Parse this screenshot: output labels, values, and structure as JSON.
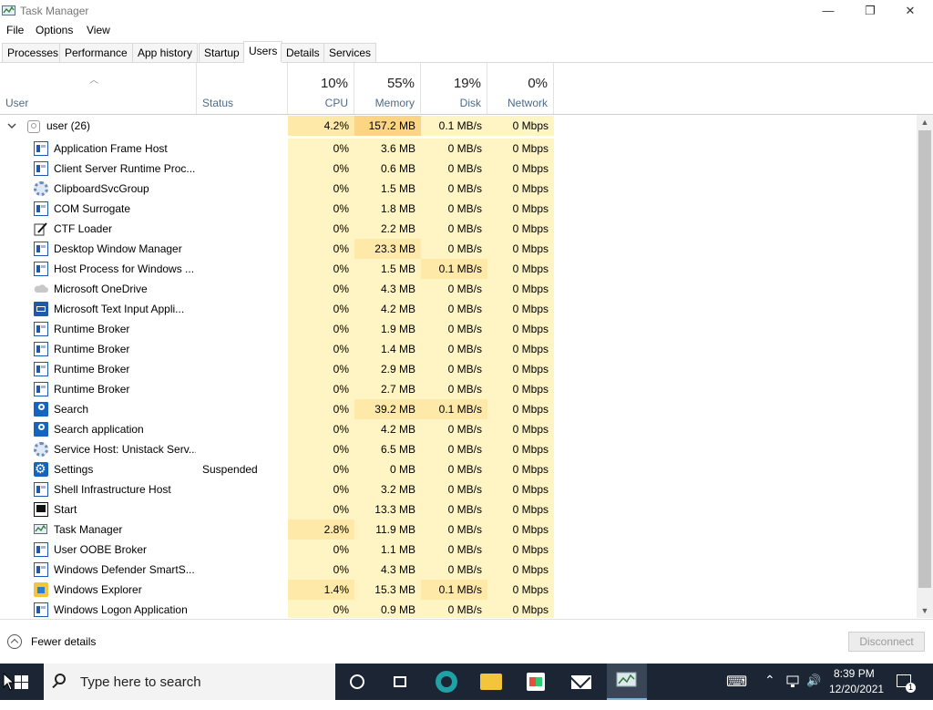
{
  "window": {
    "title": "Task Manager",
    "min_glyph": "—",
    "max_glyph": "❐",
    "close_glyph": "✕"
  },
  "menu": [
    "File",
    "Options",
    "View"
  ],
  "tabs": [
    {
      "label": "Processes",
      "active": false
    },
    {
      "label": "Performance",
      "active": false
    },
    {
      "label": "App history",
      "active": false
    },
    {
      "label": "Startup",
      "active": false
    },
    {
      "label": "Users",
      "active": true
    },
    {
      "label": "Details",
      "active": false
    },
    {
      "label": "Services",
      "active": false
    }
  ],
  "columns": {
    "user": "User",
    "status": "Status",
    "cpu": {
      "pct": "10%",
      "label": "CPU"
    },
    "memory": {
      "pct": "55%",
      "label": "Memory"
    },
    "disk": {
      "pct": "19%",
      "label": "Disk"
    },
    "network": {
      "pct": "0%",
      "label": "Network"
    }
  },
  "user_row": {
    "name": "user (26)",
    "cpu": "4.2%",
    "memory": "157.2 MB",
    "disk": "0.1 MB/s",
    "network": "0 Mbps"
  },
  "processes": [
    {
      "icon": "window-icon",
      "name": "Application Frame Host",
      "status": "",
      "cpu": "0%",
      "memory": "3.6 MB",
      "disk": "0 MB/s",
      "network": "0 Mbps"
    },
    {
      "icon": "window-icon",
      "name": "Client Server Runtime Proc...",
      "status": "",
      "cpu": "0%",
      "memory": "0.6 MB",
      "disk": "0 MB/s",
      "network": "0 Mbps"
    },
    {
      "icon": "gear-icon",
      "name": "ClipboardSvcGroup",
      "status": "",
      "cpu": "0%",
      "memory": "1.5 MB",
      "disk": "0 MB/s",
      "network": "0 Mbps"
    },
    {
      "icon": "window-icon",
      "name": "COM Surrogate",
      "status": "",
      "cpu": "0%",
      "memory": "1.8 MB",
      "disk": "0 MB/s",
      "network": "0 Mbps"
    },
    {
      "icon": "pen-icon",
      "name": "CTF Loader",
      "status": "",
      "cpu": "0%",
      "memory": "2.2 MB",
      "disk": "0 MB/s",
      "network": "0 Mbps"
    },
    {
      "icon": "window-icon",
      "name": "Desktop Window Manager",
      "status": "",
      "cpu": "0%",
      "memory": "23.3 MB",
      "disk": "0 MB/s",
      "network": "0 Mbps"
    },
    {
      "icon": "window-icon",
      "name": "Host Process for Windows ...",
      "status": "",
      "cpu": "0%",
      "memory": "1.5 MB",
      "disk": "0.1 MB/s",
      "network": "0 Mbps"
    },
    {
      "icon": "cloud-icon",
      "name": "Microsoft OneDrive",
      "status": "",
      "cpu": "0%",
      "memory": "4.3 MB",
      "disk": "0 MB/s",
      "network": "0 Mbps"
    },
    {
      "icon": "keyboard-icon",
      "name": "Microsoft Text Input Appli...",
      "status": "",
      "cpu": "0%",
      "memory": "4.2 MB",
      "disk": "0 MB/s",
      "network": "0 Mbps"
    },
    {
      "icon": "window-icon",
      "name": "Runtime Broker",
      "status": "",
      "cpu": "0%",
      "memory": "1.9 MB",
      "disk": "0 MB/s",
      "network": "0 Mbps"
    },
    {
      "icon": "window-icon",
      "name": "Runtime Broker",
      "status": "",
      "cpu": "0%",
      "memory": "1.4 MB",
      "disk": "0 MB/s",
      "network": "0 Mbps"
    },
    {
      "icon": "window-icon",
      "name": "Runtime Broker",
      "status": "",
      "cpu": "0%",
      "memory": "2.9 MB",
      "disk": "0 MB/s",
      "network": "0 Mbps"
    },
    {
      "icon": "window-icon",
      "name": "Runtime Broker",
      "status": "",
      "cpu": "0%",
      "memory": "2.7 MB",
      "disk": "0 MB/s",
      "network": "0 Mbps"
    },
    {
      "icon": "search-icon",
      "name": "Search",
      "status": "",
      "cpu": "0%",
      "memory": "39.2 MB",
      "disk": "0.1 MB/s",
      "network": "0 Mbps"
    },
    {
      "icon": "search-icon",
      "name": "Search application",
      "status": "",
      "cpu": "0%",
      "memory": "4.2 MB",
      "disk": "0 MB/s",
      "network": "0 Mbps"
    },
    {
      "icon": "gear-icon",
      "name": "Service Host: Unistack Serv...",
      "status": "",
      "cpu": "0%",
      "memory": "6.5 MB",
      "disk": "0 MB/s",
      "network": "0 Mbps"
    },
    {
      "icon": "settings-icon",
      "name": "Settings",
      "status": "Suspended",
      "cpu": "0%",
      "memory": "0 MB",
      "disk": "0 MB/s",
      "network": "0 Mbps"
    },
    {
      "icon": "window-icon",
      "name": "Shell Infrastructure Host",
      "status": "",
      "cpu": "0%",
      "memory": "3.2 MB",
      "disk": "0 MB/s",
      "network": "0 Mbps"
    },
    {
      "icon": "start-icon",
      "name": "Start",
      "status": "",
      "cpu": "0%",
      "memory": "13.3 MB",
      "disk": "0 MB/s",
      "network": "0 Mbps"
    },
    {
      "icon": "task-manager-icon",
      "name": "Task Manager",
      "status": "",
      "cpu": "2.8%",
      "memory": "11.9 MB",
      "disk": "0 MB/s",
      "network": "0 Mbps"
    },
    {
      "icon": "window-icon",
      "name": "User OOBE Broker",
      "status": "",
      "cpu": "0%",
      "memory": "1.1 MB",
      "disk": "0 MB/s",
      "network": "0 Mbps"
    },
    {
      "icon": "window-icon",
      "name": "Windows Defender SmartS...",
      "status": "",
      "cpu": "0%",
      "memory": "4.3 MB",
      "disk": "0 MB/s",
      "network": "0 Mbps"
    },
    {
      "icon": "folder-icon",
      "name": "Windows Explorer",
      "status": "",
      "cpu": "1.4%",
      "memory": "15.3 MB",
      "disk": "0.1 MB/s",
      "network": "0 Mbps"
    },
    {
      "icon": "window-icon",
      "name": "Windows Logon Application",
      "status": "",
      "cpu": "0%",
      "memory": "0.9 MB",
      "disk": "0 MB/s",
      "network": "0 Mbps"
    }
  ],
  "footer": {
    "fewer_details": "Fewer details",
    "disconnect": "Disconnect"
  },
  "taskbar": {
    "search_placeholder": "Type here to search",
    "time": "8:39 PM",
    "date": "12/20/2021",
    "notification_count": "1",
    "lang_glyph": "⌨",
    "chevron_glyph": "⌃",
    "speaker_glyph": "🔊"
  },
  "colors": {
    "heat_low": "#fff4c4",
    "heat_mid": "#ffe9a8",
    "heat_high": "#fcd584",
    "taskbar": "#1b2533"
  }
}
